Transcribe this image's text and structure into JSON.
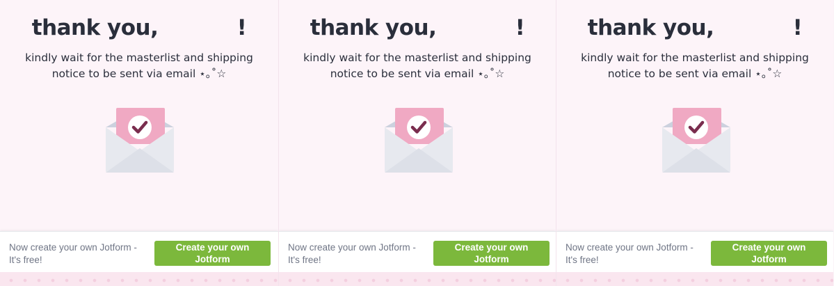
{
  "panels": [
    {
      "title": "thank you,           !",
      "message": "kindly wait for the masterlist and shipping notice to be sent via email ⋆｡˚☆",
      "icon": "envelope-checkmark-icon",
      "footer": {
        "promo": "Now create your own Jotform - It's free!",
        "cta": "Create your own Jotform"
      }
    },
    {
      "title": "thank you,           !",
      "message": "kindly wait for the masterlist and shipping notice to be sent via email ⋆｡˚☆",
      "icon": "envelope-checkmark-icon",
      "footer": {
        "promo": "Now create your own Jotform - It's free!",
        "cta": "Create your own Jotform"
      }
    },
    {
      "title": "thank you,           !",
      "message": "kindly wait for the masterlist and shipping notice to be sent via email ⋆｡˚☆",
      "icon": "envelope-checkmark-icon",
      "footer": {
        "promo": "Now create your own Jotform - It's free!",
        "cta": "Create your own Jotform"
      }
    }
  ],
  "colors": {
    "background": "#fdf4f9",
    "title": "#2a2e3b",
    "card": "#f0a9c3",
    "check": "#7a2d4e",
    "envelope": "#e7e9ef",
    "cta": "#7cb83c"
  }
}
